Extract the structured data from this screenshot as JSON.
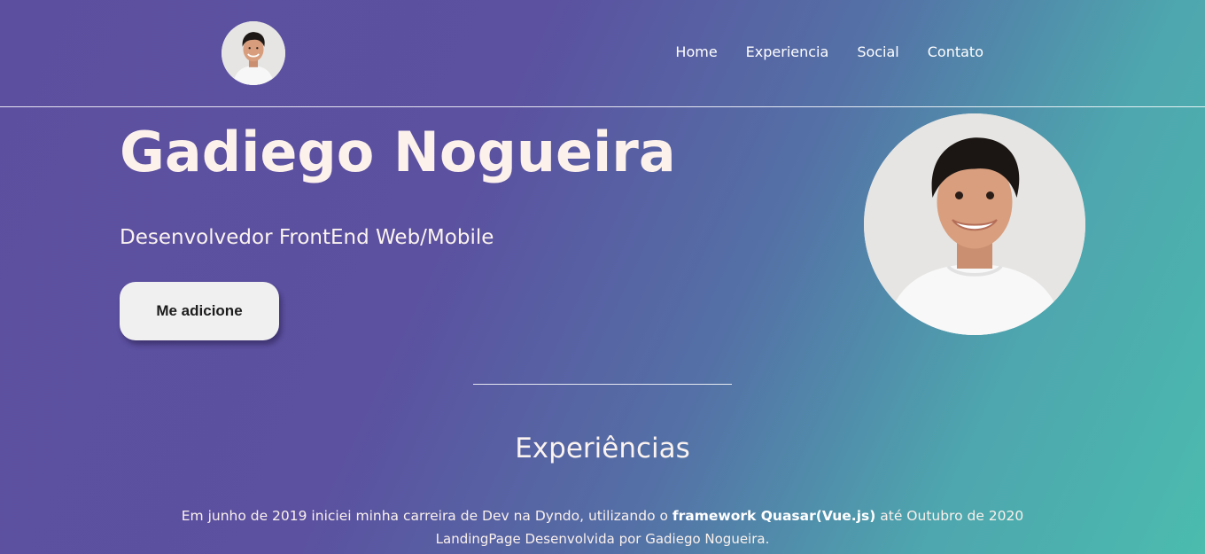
{
  "header": {
    "nav": {
      "home": "Home",
      "experiencia": "Experiencia",
      "social": "Social",
      "contato": "Contato"
    },
    "avatar_icon": "profile-photo"
  },
  "hero": {
    "name": "Gadiego Nogueira",
    "role": "Desenvolvedor FrontEnd Web/Mobile",
    "button_label": "Me adicione",
    "photo_icon": "profile-photo"
  },
  "experience": {
    "title": "Experiências",
    "text_before": "Em junho de 2019 iniciei minha carreira de Dev na Dyndo, utilizando o ",
    "text_bold": "framework Quasar(Vue.js)",
    "text_after": " até Outubro de 2020"
  },
  "footer": {
    "credit": "LandingPage Desenvolvida por Gadiego Nogueira."
  },
  "colors": {
    "gradient_start": "#5c4f9f",
    "gradient_end": "#4bbcae",
    "heading_text": "#fdf1ec",
    "button_bg": "#f1f0f0"
  }
}
